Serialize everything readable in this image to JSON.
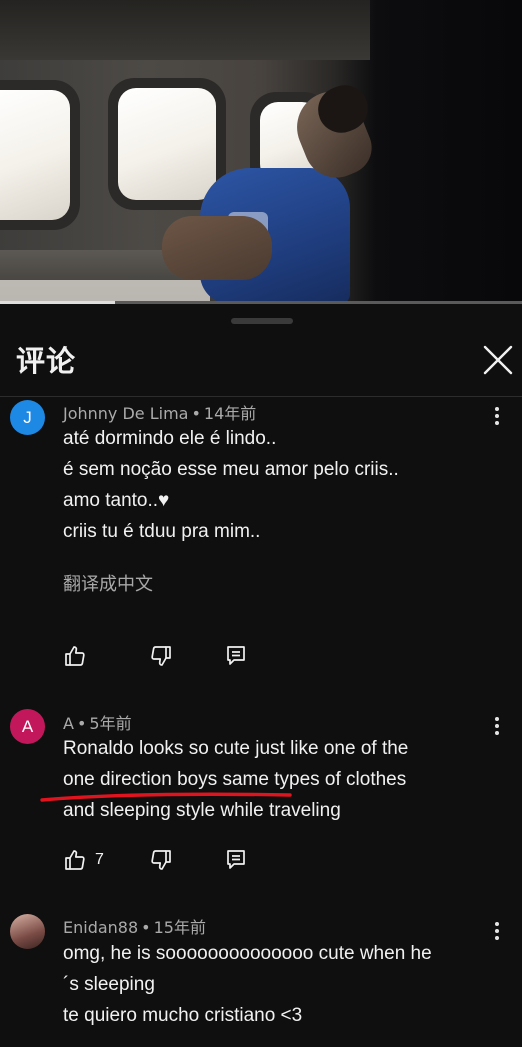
{
  "panel": {
    "title": "评论"
  },
  "video": {
    "progress": 0.22
  },
  "comments": [
    {
      "avatar_letter": "J",
      "avatar_color": "#1e88e5",
      "author": "Johnny De Lima",
      "time": "14年前",
      "lines": [
        "até dormindo ele é lindo..",
        "é sem noção esse meu amor pelo criis..",
        "amo tanto..♥",
        "criis tu é tduu pra mim.."
      ],
      "translate_label": "翻译成中文",
      "likes": ""
    },
    {
      "avatar_letter": "A",
      "avatar_color": "#c2185b",
      "author": "A",
      "time": "5年前",
      "lines": [
        "Ronaldo looks so cute just like one of the",
        "one direction boys same types of clothes",
        "and sleeping style while traveling"
      ],
      "likes": "7"
    },
    {
      "avatar_letter": "",
      "author": "Enidan88",
      "time": "15年前",
      "lines": [
        "omg, he is soooooooooooooo cute when he",
        "´s sleeping",
        "te quiero mucho cristiano <3"
      ]
    }
  ],
  "icons": {
    "close": "close-icon",
    "like": "thumbs-up-icon",
    "dislike": "thumbs-down-icon",
    "reply": "reply-icon",
    "more": "more-vertical-icon"
  },
  "colors": {
    "background": "#0f0f0f",
    "annotation": "#e0141e"
  }
}
